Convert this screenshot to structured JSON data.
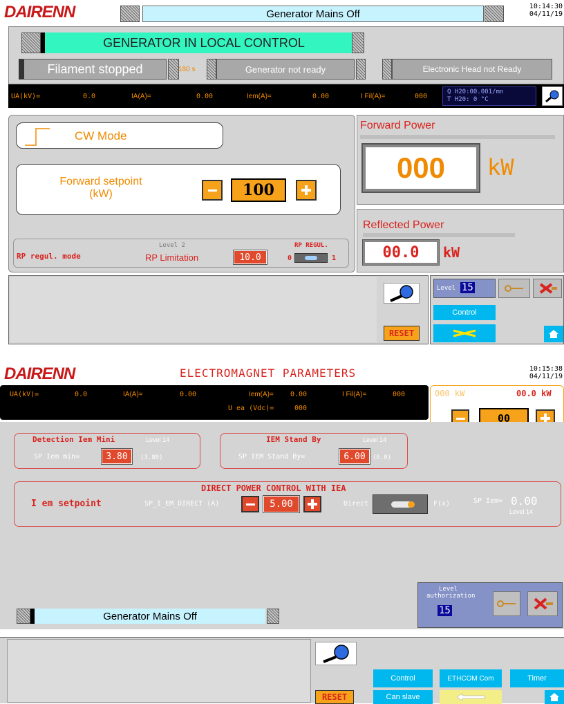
{
  "brand": "DAIRENN",
  "screen1": {
    "title": "Generator Mains Off",
    "time": "10:14:30",
    "date": "04/11/19",
    "status_main": "GENERATOR IN LOCAL CONTROL",
    "filament": "Filament stopped",
    "filament_timer": "180 s",
    "generator_status": "Generator not ready",
    "head_status": "Electronic Head not Ready",
    "meas": {
      "ua_label": "UA(kV)=",
      "ua_value": "0.0",
      "ia_label": "IA(A)=",
      "ia_value": "0.00",
      "iem_label": "Iem(A)=",
      "iem_value": "0.00",
      "ifil_label": "I Fil(A)=",
      "ifil_value": "000",
      "q_line": "Q H20:00.001/mn",
      "t_line": "T H20: 0 °C"
    },
    "mode": "CW Mode",
    "setpoint_label_1": "Forward setpoint",
    "setpoint_label_2": "(kW)",
    "setpoint_value": "100",
    "rp_mode_label": "RP regul. mode",
    "rp_level": "Level 2",
    "rp_limitation": "RP Limitation",
    "rp_value": "10.0",
    "rp_regul": "RP REGUL.",
    "rp_zero": "0",
    "rp_one": "1",
    "forward_power_title": "Forward Power",
    "forward_power_value": "000",
    "forward_power_unit": "kW",
    "reflected_power_title": "Reflected Power",
    "reflected_power_value": "00.0",
    "reflected_power_unit": "kW",
    "level_label": "Level",
    "level_value": "15",
    "control": "Control",
    "reset": "RESET"
  },
  "screen2": {
    "title": "ELECTROMAGNET PARAMETERS",
    "time": "10:15:38",
    "date": "04/11/19",
    "meas": {
      "ua_label": "UA(kV)=",
      "ua_value": "0.0",
      "ia_label": "IA(A)=",
      "ia_value": "0.00",
      "iem_label": "Iem(A)=",
      "iem_value": "0.00",
      "ifil_label": "I Fil(A)=",
      "ifil_value": "000",
      "uea_label": "U ea (Vdc)=",
      "uea_value": "000"
    },
    "power_kw_left": "000 kW",
    "power_kw_right": "00.0 kW",
    "stepper_value": "00",
    "detection_title": "Detection Iem Mini",
    "detection_level": "Level 14",
    "sp_iem_min_label": "SP Iem min=",
    "sp_iem_min_value": "3.80",
    "sp_iem_min_ref": "(3.80)",
    "standby_title": "IEM Stand By",
    "standby_level": "Level 14",
    "standby_label": "SP IEM Stand By=",
    "standby_value": "6.00",
    "standby_ref": "(6.0)",
    "direct_title": "DIRECT POWER CONTROL WITH IEA",
    "iem_setpoint_label": "I em setpoint",
    "sp_direct_label": "SP_I_EM_DIRECT (A)",
    "sp_direct_value": "5.00",
    "direct_label": "Direct",
    "fx_label": "F(x)",
    "sp_iem_label": "SP Iem=",
    "sp_iem_value": "0.00",
    "sp_iem_level": "Level 14",
    "mains_status": "Generator Mains Off",
    "level_auth_1": "Level",
    "level_auth_2": "authorization",
    "level_value": "15",
    "reset": "RESET",
    "control": "Control",
    "ethcom": "ETHCOM Com",
    "timer": "Timer",
    "can_slave": "Can slave"
  }
}
